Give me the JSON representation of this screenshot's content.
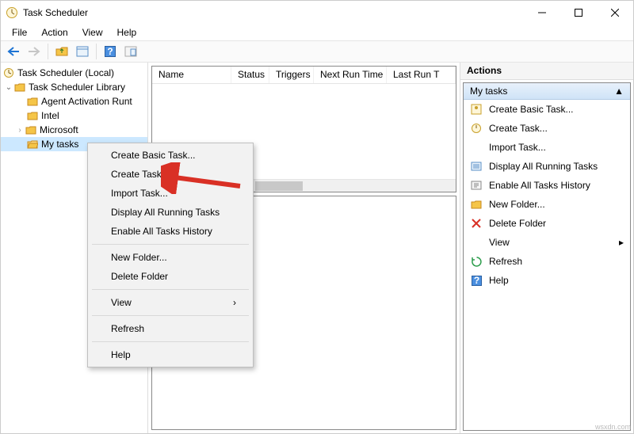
{
  "title": "Task Scheduler",
  "menus": [
    "File",
    "Action",
    "View",
    "Help"
  ],
  "tree": {
    "root": "Task Scheduler (Local)",
    "lib": "Task Scheduler Library",
    "items": [
      "Agent Activation Runt",
      "Intel",
      "Microsoft",
      "My tasks"
    ]
  },
  "columns": [
    "Name",
    "Status",
    "Triggers",
    "Next Run Time",
    "Last Run T"
  ],
  "actions": {
    "header": "Actions",
    "group": "My tasks",
    "items": [
      "Create Basic Task...",
      "Create Task...",
      "Import Task...",
      "Display All Running Tasks",
      "Enable All Tasks History",
      "New Folder...",
      "Delete Folder",
      "View",
      "Refresh",
      "Help"
    ]
  },
  "context_menu": [
    "Create Basic Task...",
    "Create Task...",
    "Import Task...",
    "Display All Running Tasks",
    "Enable All Tasks History",
    "New Folder...",
    "Delete Folder",
    "View",
    "Refresh",
    "Help"
  ],
  "watermark": "wsxdn.com"
}
